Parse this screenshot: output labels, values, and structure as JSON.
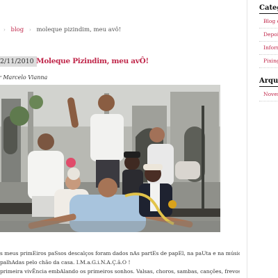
{
  "breadcrumb": {
    "current_section": "blog",
    "current_page": "moleque pizindim, meu avô!"
  },
  "post": {
    "date": "2/11/2010",
    "title": "Moleque Pizindim, meu avÔ!",
    "byline": "r Marcelo Vianna",
    "photo_description": "group-photo",
    "paragraphs": [
      "s meus primEiros paSsos descalços foram dados nAs partEs de papEl, na paUta e na músicA",
      "palhAdas pelo chão da casa. I.M.a.G.i.N.A.Ç.ã.O !",
      "primeira vivÊncia embAlando os primeiros sonhos. Valsas, choros, sambas, canções, frevos,"
    ]
  },
  "sidebar": {
    "categories_heading": "Categ",
    "categories": [
      "Blog d",
      "Depoi",
      "Inform",
      "Pixing"
    ],
    "archive_heading": "Arqu",
    "archive": [
      "Novem"
    ]
  },
  "colors": {
    "accent": "#c0274a",
    "date_background": "#dcdcdc"
  }
}
